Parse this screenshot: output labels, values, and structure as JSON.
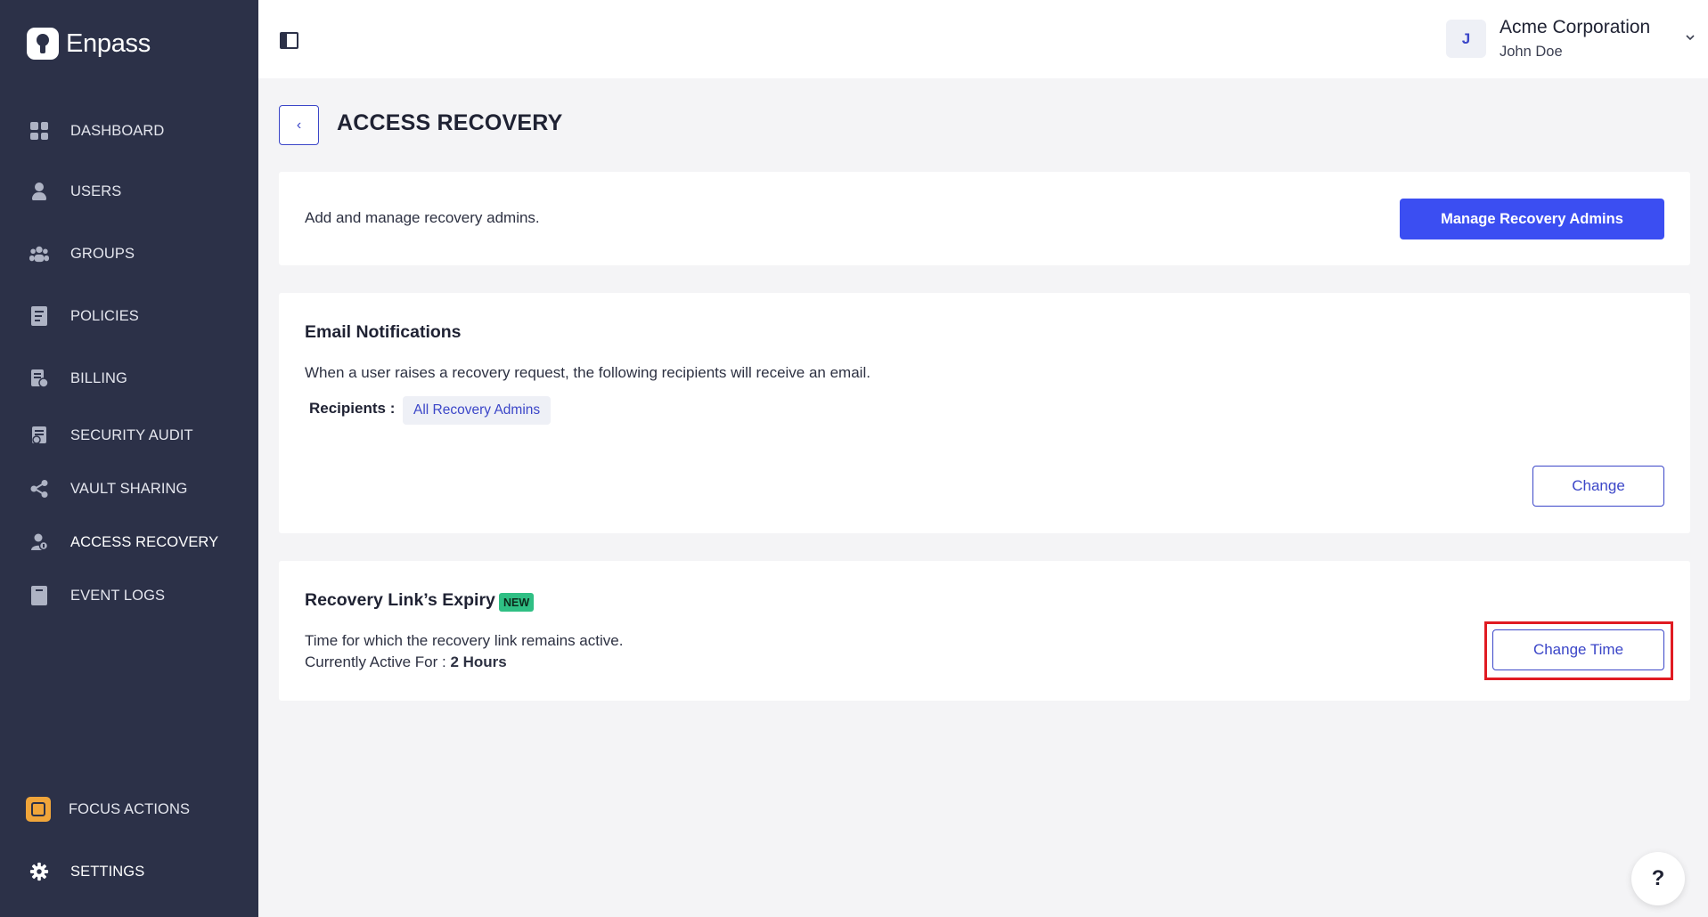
{
  "app": {
    "name": "Enpass"
  },
  "sidebar": {
    "items": [
      {
        "label": "DASHBOARD",
        "icon": "dashboard-icon"
      },
      {
        "label": "USERS",
        "icon": "user-icon"
      },
      {
        "label": "GROUPS",
        "icon": "groups-icon"
      },
      {
        "label": "POLICIES",
        "icon": "policies-icon"
      },
      {
        "label": "BILLING",
        "icon": "billing-icon"
      },
      {
        "label": "SECURITY AUDIT",
        "icon": "security-audit-icon"
      },
      {
        "label": "VAULT SHARING",
        "icon": "share-icon"
      },
      {
        "label": "ACCESS RECOVERY",
        "icon": "access-recovery-icon"
      },
      {
        "label": "EVENT LOGS",
        "icon": "event-logs-icon"
      }
    ],
    "focus_actions": {
      "label": "FOCUS ACTIONS",
      "icon": "focus-actions-icon"
    },
    "settings": {
      "label": "SETTINGS",
      "icon": "gear-icon"
    }
  },
  "topbar": {
    "avatar_initial": "J",
    "org_name": "Acme Corporation",
    "user_name": "John Doe"
  },
  "page": {
    "title": "ACCESS RECOVERY",
    "back_icon": "‹"
  },
  "recovery_admins": {
    "description": "Add and manage recovery admins.",
    "button_label": "Manage Recovery Admins"
  },
  "email_notifications": {
    "heading": "Email Notifications",
    "description": "When a user raises a recovery request, the following recipients will receive an email.",
    "recipients_label": "Recipients :",
    "recipients_value": "All Recovery Admins",
    "change_label": "Change"
  },
  "link_expiry": {
    "heading": "Recovery Link’s Expiry",
    "badge": "NEW",
    "description": "Time for which the recovery link remains active.",
    "active_prefix": "Currently Active For :",
    "active_value": "2 Hours",
    "change_time_label": "Change Time"
  },
  "help": {
    "label": "?"
  },
  "colors": {
    "sidebar_bg": "#2c3148",
    "accent": "#3b4ef2",
    "badge_green": "#2fbf84",
    "highlight_red": "#e01b22"
  }
}
